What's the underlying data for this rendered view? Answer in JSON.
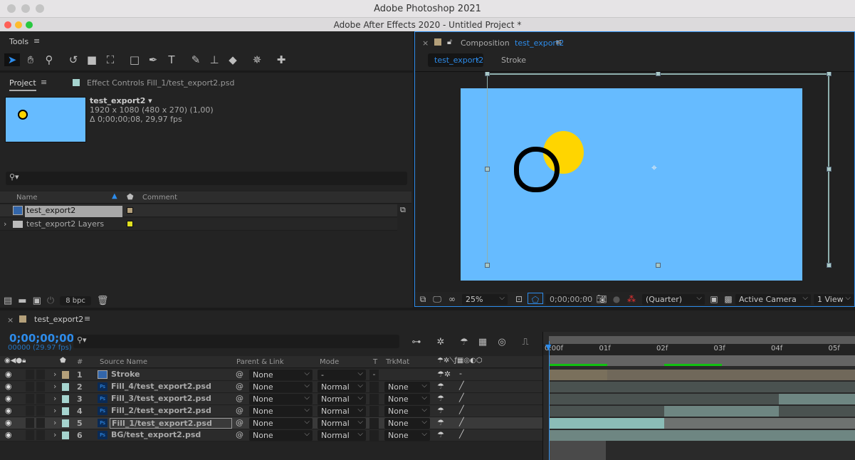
{
  "os_title": "Adobe Photoshop 2021",
  "window_title": "Adobe After Effects 2020 - Untitled Project *",
  "tools": {
    "title": "Tools",
    "icons": [
      "selection-icon",
      "hand-icon",
      "zoom-icon",
      "rotate-icon",
      "camera-icon",
      "pan-behind-icon",
      "rectangle-icon",
      "pen-icon",
      "type-icon",
      "brush-icon",
      "clone-stamp-icon",
      "eraser-icon",
      "puppet-icon",
      "pin-icon"
    ]
  },
  "project": {
    "tab": "Project",
    "effect_tab": "Effect Controls Fill_1/test_export2.psd",
    "comp_name": "test_export2 ▾",
    "comp_size": "1920 x 1080  (480 x 270) (1,00)",
    "comp_duration": "Δ 0;00;00;08, 29,97 fps",
    "columns": {
      "name": "Name",
      "comment": "Comment"
    },
    "items": [
      {
        "name": "test_export2",
        "color": "#b4a07a",
        "selected": true,
        "type": "composition"
      },
      {
        "name": "test_export2 Layers",
        "color": "#e0e020",
        "selected": false,
        "type": "folder"
      }
    ],
    "bpc": "8 bpc"
  },
  "composition": {
    "title_prefix": "Composition",
    "title_name": "test_export2",
    "breadcrumbs": [
      "test_export2",
      "Stroke"
    ],
    "canvas_color": "#66bbff",
    "toolbar": {
      "zoom": "25%",
      "timecode": "0;00;00;00",
      "resolution": "(Quarter)",
      "camera": "Active Camera",
      "views": "1 View"
    }
  },
  "timeline": {
    "tab": "test_export2",
    "timecode": "0;00;00;00",
    "frame_info": "00000 (29.97 fps)",
    "headers": {
      "num": "#",
      "source": "Source Name",
      "parent": "Parent & Link",
      "mode": "Mode",
      "t": "T",
      "trkmat": "TrkMat"
    },
    "ruler": [
      "0:00f",
      "01f",
      "02f",
      "03f",
      "04f",
      "05f"
    ],
    "work_area_frames": [
      [
        0,
        1
      ],
      [
        2,
        3
      ]
    ],
    "layers": [
      {
        "num": "1",
        "name": "Stroke",
        "color": "#b4a07a",
        "parent": "None",
        "mode": "-",
        "trkmat": "",
        "type": "comp",
        "segments": [
          [
            0,
            1,
            "#7a705c"
          ],
          [
            1,
            6,
            "#70685a"
          ]
        ]
      },
      {
        "num": "2",
        "name": "Fill_4/test_export2.psd",
        "color": "#a5d4cf",
        "parent": "None",
        "mode": "Normal",
        "trkmat": "None",
        "type": "psd",
        "segments": [
          [
            0,
            6,
            "#4a5250"
          ]
        ]
      },
      {
        "num": "3",
        "name": "Fill_3/test_export2.psd",
        "color": "#a5d4cf",
        "parent": "None",
        "mode": "Normal",
        "trkmat": "None",
        "type": "psd",
        "segments": [
          [
            0,
            4,
            "#4a5250"
          ],
          [
            4,
            6,
            "#6e8682"
          ]
        ]
      },
      {
        "num": "4",
        "name": "Fill_2/test_export2.psd",
        "color": "#a5d4cf",
        "parent": "None",
        "mode": "Normal",
        "trkmat": "None",
        "type": "psd",
        "segments": [
          [
            0,
            2,
            "#4a5250"
          ],
          [
            2,
            4,
            "#6e8682"
          ],
          [
            4,
            6,
            "#4a5250"
          ]
        ]
      },
      {
        "num": "5",
        "name": "Fill_1/test_export2.psd",
        "color": "#a5d4cf",
        "parent": "None",
        "mode": "Normal",
        "trkmat": "None",
        "type": "psd",
        "selected": true,
        "segments": [
          [
            0,
            2,
            "#8bbdb7"
          ],
          [
            2,
            6,
            "#6e7270"
          ]
        ]
      },
      {
        "num": "6",
        "name": "BG/test_export2.psd",
        "color": "#a5d4cf",
        "parent": "None",
        "mode": "Normal",
        "trkmat": "None",
        "type": "psd",
        "segments": [
          [
            0,
            6,
            "#6e8682"
          ]
        ]
      }
    ]
  },
  "accent": "#2d8ceb"
}
